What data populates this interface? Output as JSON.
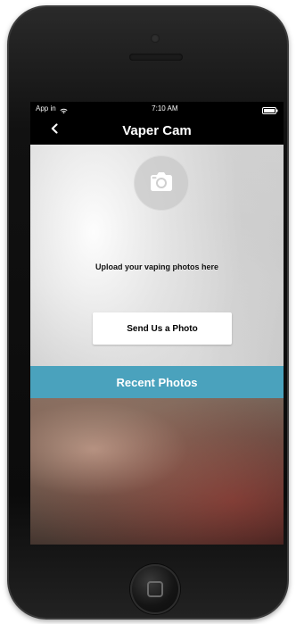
{
  "status_bar": {
    "carrier": "App in",
    "time": "7:10 AM"
  },
  "nav": {
    "title": "Vaper Cam"
  },
  "content": {
    "upload_instructions": "Upload your vaping photos here",
    "send_photo_button_label": "Send Us a Photo",
    "recent_photos_label": "Recent Photos"
  },
  "colors": {
    "accent_bar": "#4aa2bd",
    "nav_bg": "#000000",
    "button_bg": "#ffffff"
  },
  "icons": {
    "back": "chevron-left-icon",
    "camera": "camera-icon",
    "wifi": "wifi-icon",
    "battery": "battery-icon",
    "home_button": "home-button-icon"
  }
}
